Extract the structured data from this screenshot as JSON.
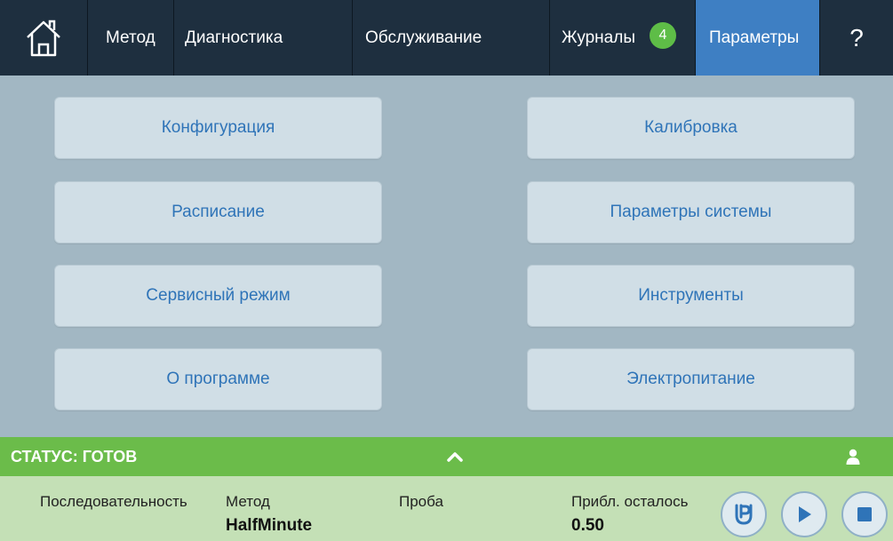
{
  "nav": {
    "tabs": [
      {
        "label": "Метод"
      },
      {
        "label": "Диагностика"
      },
      {
        "label": "Обслуживание"
      },
      {
        "label": "Журналы",
        "badge": "4"
      },
      {
        "label": "Параметры",
        "active": true
      }
    ],
    "help_label": "?"
  },
  "main": {
    "buttons": [
      {
        "label": "Конфигурация"
      },
      {
        "label": "Калибровка"
      },
      {
        "label": "Расписание"
      },
      {
        "label": "Параметры системы"
      },
      {
        "label": "Сервисный режим"
      },
      {
        "label": "Инструменты"
      },
      {
        "label": "О программе"
      },
      {
        "label": "Электропитание"
      }
    ]
  },
  "status": {
    "text": "СТАТУС: ГОТОВ",
    "expand_icon": "chevron-up-icon",
    "user_icon": "user-icon"
  },
  "info": {
    "sequence_label": "Последовательность",
    "method_label": "Метод",
    "method_value": "HalfMinute",
    "sample_label": "Проба",
    "remaining_label": "Прибл. осталось",
    "remaining_value": "0.50"
  },
  "controls": {
    "inject_icon": "probe-icon",
    "play_icon": "play-icon",
    "stop_icon": "stop-icon"
  },
  "colors": {
    "nav_bg": "#1e2f3f",
    "nav_active": "#3e7fc3",
    "badge": "#5ebd47",
    "status_green": "#6bbc4a",
    "info_bg": "#c4e0b6",
    "panel_bg": "#a2b7c3",
    "button_bg": "#d0dee6",
    "button_text": "#2f74b8"
  }
}
